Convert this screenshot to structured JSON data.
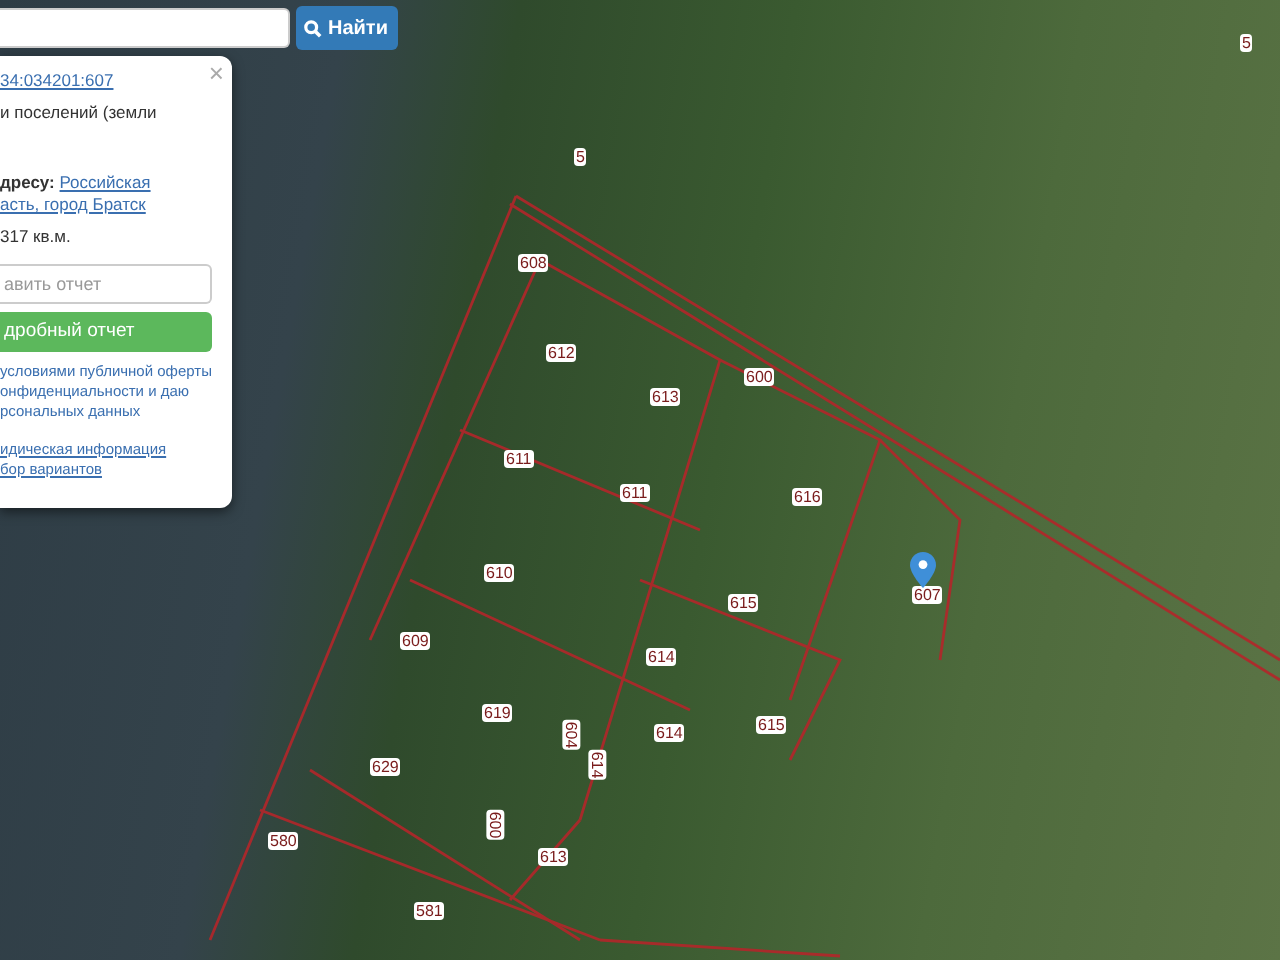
{
  "search": {
    "button": "Найти"
  },
  "popup": {
    "close": "×",
    "cadastral_number": "34:034201:607",
    "category": "и поселений (земли",
    "address_label": "дресу:",
    "address_links": [
      "Российская",
      "асть, город Братск"
    ],
    "area": "317 кв.м.",
    "email_placeholder": "авить отчет",
    "report_button": "дробный отчет",
    "consent_lines": [
      "условиями публичной оферты",
      "онфиденциальности и даю",
      "рсональных данных"
    ],
    "links": [
      "идическая информация",
      "бор вариантов"
    ]
  },
  "parcel_labels": [
    {
      "text": "5",
      "vertical": false
    },
    {
      "text": "5",
      "vertical": false
    },
    {
      "text": "608",
      "vertical": false
    },
    {
      "text": "612",
      "vertical": false
    },
    {
      "text": "613",
      "vertical": false
    },
    {
      "text": "600",
      "vertical": false
    },
    {
      "text": "611",
      "vertical": false
    },
    {
      "text": "611",
      "vertical": false
    },
    {
      "text": "616",
      "vertical": false
    },
    {
      "text": "610",
      "vertical": false
    },
    {
      "text": "615",
      "vertical": false
    },
    {
      "text": "607",
      "vertical": false
    },
    {
      "text": "609",
      "vertical": false
    },
    {
      "text": "614",
      "vertical": false
    },
    {
      "text": "619",
      "vertical": false
    },
    {
      "text": "604",
      "vertical": true
    },
    {
      "text": "614",
      "vertical": false
    },
    {
      "text": "614",
      "vertical": true
    },
    {
      "text": "615",
      "vertical": false
    },
    {
      "text": "629",
      "vertical": false
    },
    {
      "text": "580",
      "vertical": false
    },
    {
      "text": "600",
      "vertical": true
    },
    {
      "text": "613",
      "vertical": false
    },
    {
      "text": "581",
      "vertical": false
    }
  ]
}
